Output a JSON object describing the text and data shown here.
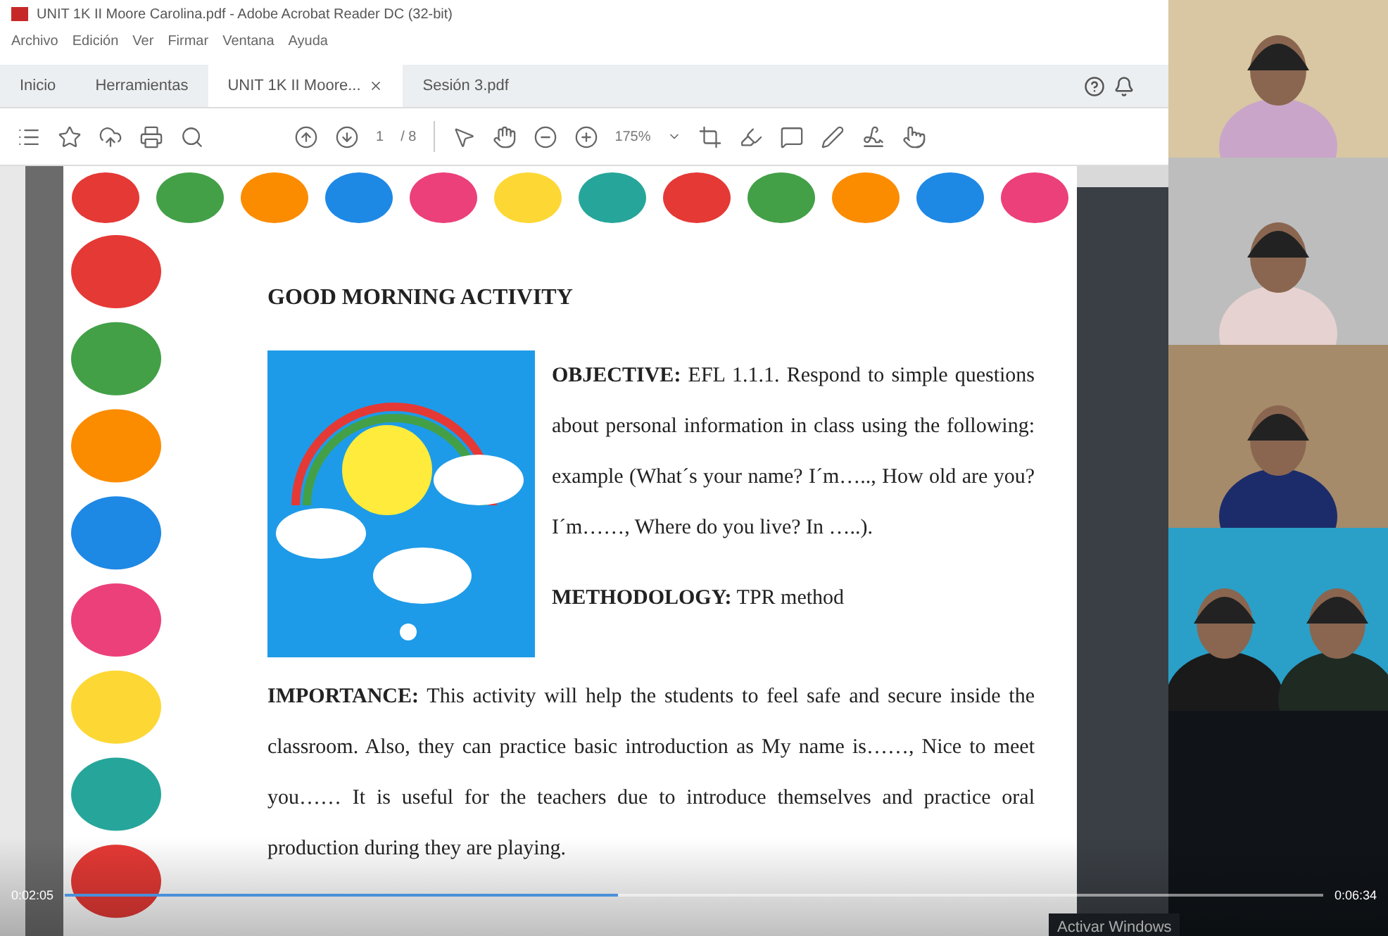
{
  "window": {
    "title": "UNIT 1K II Moore Carolina.pdf - Adobe Acrobat Reader DC (32-bit)",
    "menu": [
      "Archivo",
      "Edición",
      "Ver",
      "Firmar",
      "Ventana",
      "Ayuda"
    ]
  },
  "tabs": [
    {
      "label": "Inicio",
      "selected": false,
      "closable": false
    },
    {
      "label": "Herramientas",
      "selected": false,
      "closable": false
    },
    {
      "label": "UNIT 1K II Moore...",
      "selected": true,
      "closable": true
    },
    {
      "label": "Sesión 3.pdf",
      "selected": false,
      "closable": false
    }
  ],
  "toolbar": {
    "page": "1",
    "total": "/ 8",
    "zoom": "175%"
  },
  "document": {
    "title": "GOOD MORNING ACTIVITY",
    "objective": "**OBJECTIVE:** EFL 1.1.1. Respond to simple questions about personal information in class using the following: example (What´s your name? I´m….., How old are you? I´m……, Where do you live? In …..).",
    "methodology": "**METHODOLOGY:** TPR method",
    "importance": "**IMPORTANCE:** This activity will help the students to feel safe and secure inside the classroom. Also, they can practice basic introduction as My name is……, Nice to meet you…… It is useful for the teachers due to introduce themselves and practice oral production during they are playing."
  },
  "notice": "Activar Windows",
  "player": {
    "elapsed": "0:02:05",
    "duration": "0:06:34",
    "level": 0.44
  }
}
